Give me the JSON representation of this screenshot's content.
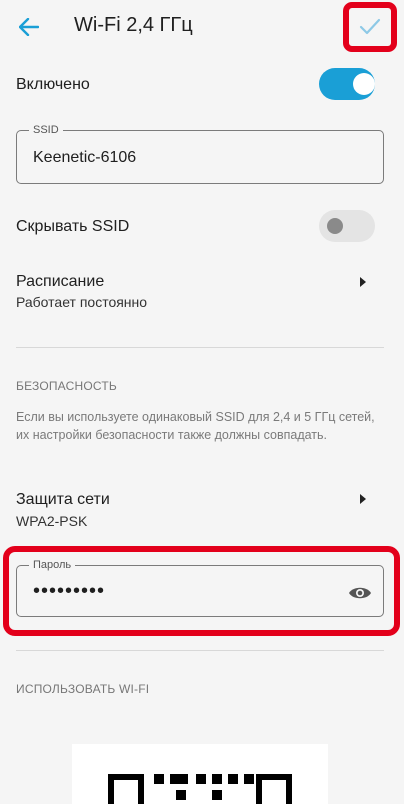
{
  "appbar": {
    "title": "Wi-Fi 2,4 ГГц",
    "back_icon": "arrow-back-icon",
    "save_icon": "check-icon",
    "accent": "#1a9fd6",
    "highlight": "#e3001b"
  },
  "enabled": {
    "label": "Включено",
    "checked": true
  },
  "ssid": {
    "legend": "SSID",
    "value": "Keenetic-6106"
  },
  "hide_ssid": {
    "label": "Скрывать SSID",
    "checked": false
  },
  "schedule": {
    "label": "Расписание",
    "value": "Работает постоянно"
  },
  "security": {
    "section_title": "БЕЗОПАСНОСТЬ",
    "help": "Если вы используете одинаковый SSID для 2,4 и 5 ГГц сетей, их настройки безопасности также должны совпадать.",
    "protection_label": "Защита сети",
    "protection_value": "WPA2-PSK"
  },
  "password": {
    "legend": "Пароль",
    "masked": "•••••••••",
    "eye_icon": "eye-icon"
  },
  "use_wifi": {
    "section_title": "ИСПОЛЬЗОВАТЬ WI-FI"
  }
}
